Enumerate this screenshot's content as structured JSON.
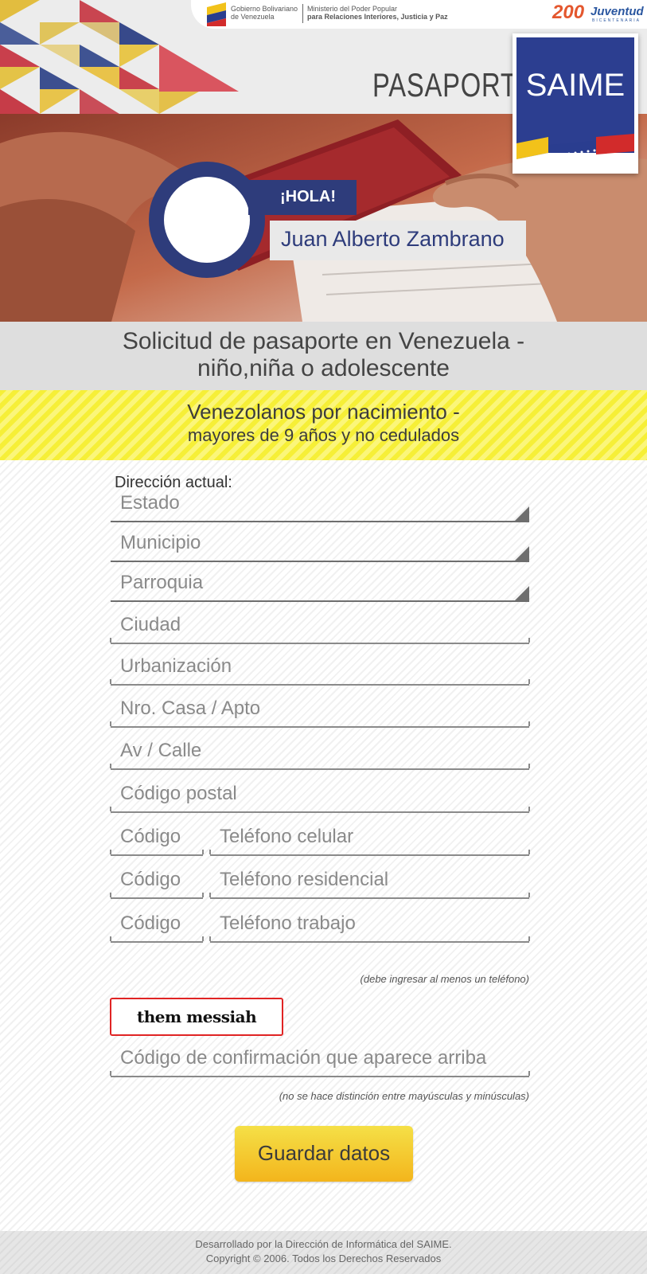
{
  "header": {
    "gov_line1": "Gobierno Bolivariano",
    "gov_line2": "de Venezuela",
    "ministry_line1": "Ministerio del Poder Popular",
    "ministry_line2": "para Relaciones Interiores, Justicia y Paz",
    "bicentenario_num": "200",
    "bicentenario_text": "Juventud",
    "bicentenario_sub": "BICENTENARIA",
    "pasaporte": "PASAPORTE",
    "saime": "SAIME",
    "greeting": "¡HOLA!",
    "user_name": "Juan Alberto Zambrano"
  },
  "titles": {
    "line1": "Solicitud de pasaporte en Venezuela -",
    "line2": "niño,niña o adolescente",
    "sub_line1": "Venezolanos por nacimiento -",
    "sub_line2": "mayores de 9 años y no cedulados"
  },
  "form": {
    "address_label": "Dirección actual:",
    "estado": "Estado",
    "municipio": "Municipio",
    "parroquia": "Parroquia",
    "ciudad": "Ciudad",
    "urbanizacion": "Urbanización",
    "nro_casa": "Nro. Casa / Apto",
    "av_calle": "Av / Calle",
    "codigo_postal": "Código postal",
    "code_placeholder": "Código",
    "tel_celular": "Teléfono celular",
    "tel_residencial": "Teléfono residencial",
    "tel_trabajo": "Teléfono trabajo",
    "phone_note": "(debe ingresar al menos un teléfono)",
    "captcha_text": "them messiah",
    "captcha_input": "Código de confirmación que aparece arriba",
    "case_note": "(no se hace distinción entre mayúsculas y minúsculas)",
    "save_label": "Guardar datos"
  },
  "footer": {
    "line1": "Desarrollado por la Dirección de Informática del SAIME.",
    "line2": "Copyright © 2006. Todos los Derechos Reservados"
  },
  "colors": {
    "brand_blue": "#2e3c7b",
    "highlight_yellow": "#f6ef37",
    "button_yellow": "#f3b51c",
    "captcha_border": "#e02424"
  }
}
